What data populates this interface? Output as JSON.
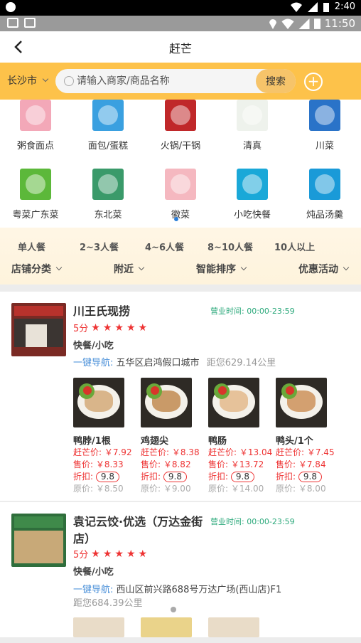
{
  "status_bar": {
    "time": "2:40"
  },
  "notification_bar": {
    "time": "11:50"
  },
  "header": {
    "title": "赶芒"
  },
  "search": {
    "city": "长沙市",
    "placeholder": "请输入商家/商品名称",
    "button": "搜索"
  },
  "categories": [
    {
      "label": "粥食面点",
      "color": "#f3a8b8"
    },
    {
      "label": "面包/蛋糕",
      "color": "#3aa0e0"
    },
    {
      "label": "火锅/干锅",
      "color": "#c0282a"
    },
    {
      "label": "清真",
      "color": "#eef2ec"
    },
    {
      "label": "川菜",
      "color": "#2a73c8"
    },
    {
      "label": "粤菜广东菜",
      "color": "#5cb83a"
    },
    {
      "label": "东北菜",
      "color": "#3a9a6a"
    },
    {
      "label": "徽菜",
      "color": "#f5b8c0"
    },
    {
      "label": "小吃快餐",
      "color": "#1aa8d8"
    },
    {
      "label": "炖品汤羹",
      "color": "#1a9ad8"
    }
  ],
  "people_filters": [
    "单人餐",
    "2~3人餐",
    "4~6人餐",
    "8~10人餐",
    "10人以上"
  ],
  "sort_filters": [
    "店铺分类",
    "附近",
    "智能排序",
    "优惠活动"
  ],
  "shops": [
    {
      "name": "川王氏现捞",
      "hours": "营业时间: 00:00-23:59",
      "score": "5分",
      "type": "快餐/小吃",
      "nav_label": "一键导航:",
      "address": "五华区启鸿假口城市",
      "distance": "距您629.14公里",
      "products": [
        {
          "name": "鸭脖/1根",
          "gm_price": "赶芒价: ￥7.92",
          "price": "售价: ￥8.33",
          "discount_label": "折扣:",
          "discount": "9.8",
          "orig": "原价: ￥8.50"
        },
        {
          "name": "鸡翅尖",
          "gm_price": "赶芒价: ￥8.38",
          "price": "售价: ￥8.82",
          "discount_label": "折扣:",
          "discount": "9.8",
          "orig": "原价: ￥9.00"
        },
        {
          "name": "鸭肠",
          "gm_price": "赶芒价: ￥13.04",
          "price": "售价: ￥13.72",
          "discount_label": "折扣:",
          "discount": "9.8",
          "orig": "原价: ￥14.00"
        },
        {
          "name": "鸭头/1个",
          "gm_price": "赶芒价: ￥7.45",
          "price": "售价: ￥7.84",
          "discount_label": "折扣:",
          "discount": "9.8",
          "orig": "原价: ￥8.00"
        }
      ]
    },
    {
      "name_line1": "袁记云饺·优选（万达金街",
      "name_line2": "店）",
      "hours": "营业时间: 00:00-23:59",
      "score": "5分",
      "type": "快餐/小吃",
      "nav_label": "一键导航:",
      "address": "西山区前兴路688号万达广场(西山店)F1",
      "distance": "距您684.39公里"
    }
  ]
}
